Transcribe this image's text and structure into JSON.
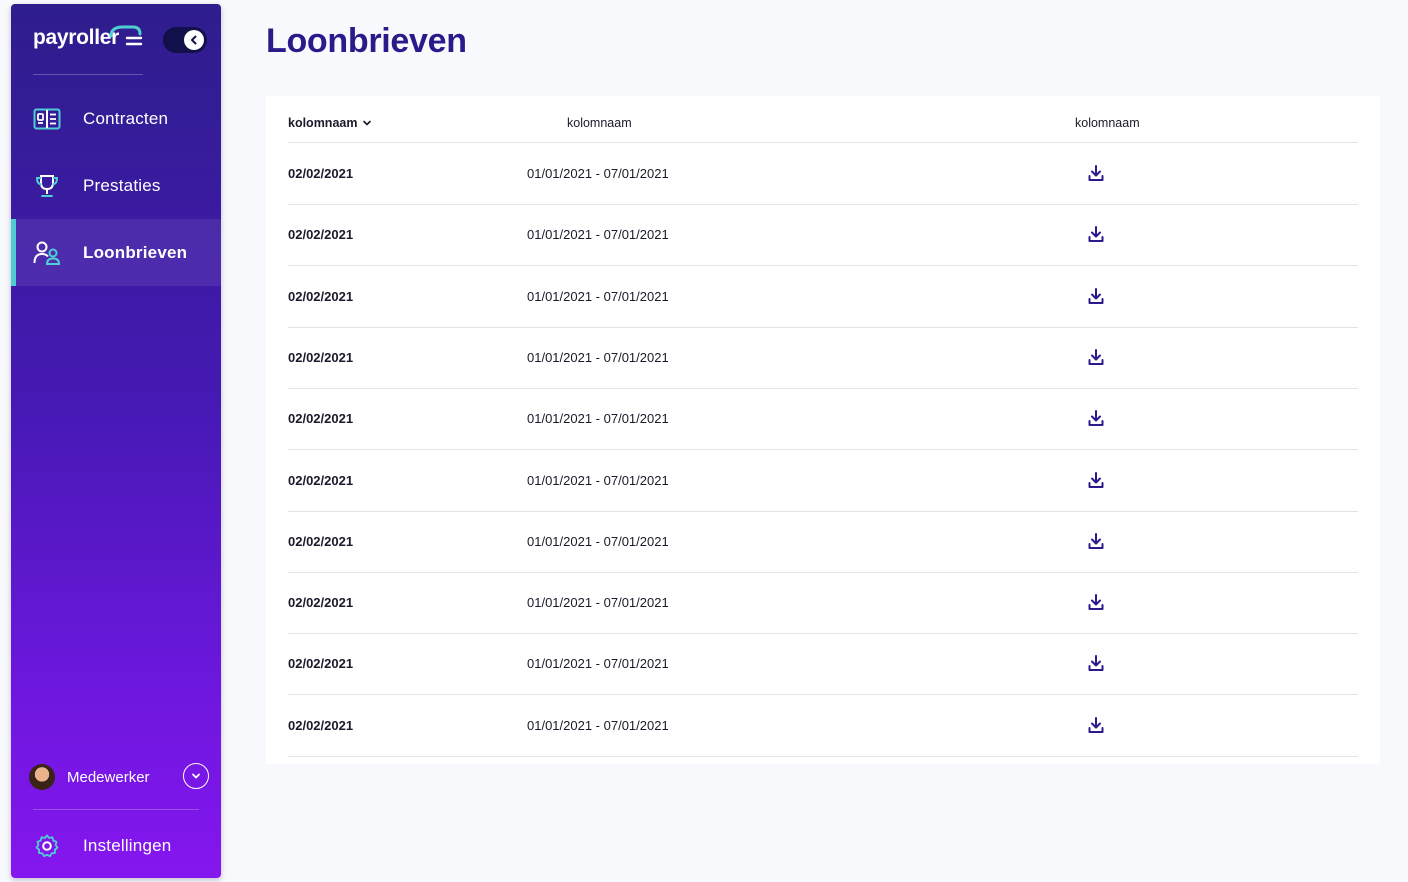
{
  "brand": {
    "name": "payroller",
    "accent": "#4ecdd2"
  },
  "sidebar": {
    "toggle_icon": "chevron-left-icon",
    "items": [
      {
        "label": "Contracten",
        "icon": "contract-card-icon",
        "active": false
      },
      {
        "label": "Prestaties",
        "icon": "trophy-icon",
        "active": false
      },
      {
        "label": "Loonbrieven",
        "icon": "users-icon",
        "active": true
      }
    ],
    "user": {
      "name": "Medewerker",
      "dropdown_icon": "chevron-down-icon"
    },
    "settings": {
      "label": "Instellingen",
      "icon": "gear-icon"
    }
  },
  "page": {
    "title": "Loonbrieven"
  },
  "table": {
    "headers": [
      "kolomnaam",
      "kolomnaam",
      "kolomnaam"
    ],
    "sort_icon": "chevron-down-icon",
    "rows": [
      {
        "date": "02/02/2021",
        "period": "01/01/2021 - 07/01/2021"
      },
      {
        "date": "02/02/2021",
        "period": "01/01/2021 - 07/01/2021"
      },
      {
        "date": "02/02/2021",
        "period": "01/01/2021 - 07/01/2021"
      },
      {
        "date": "02/02/2021",
        "period": "01/01/2021 - 07/01/2021"
      },
      {
        "date": "02/02/2021",
        "period": "01/01/2021 - 07/01/2021"
      },
      {
        "date": "02/02/2021",
        "period": "01/01/2021 - 07/01/2021"
      },
      {
        "date": "02/02/2021",
        "period": "01/01/2021 - 07/01/2021"
      },
      {
        "date": "02/02/2021",
        "period": "01/01/2021 - 07/01/2021"
      },
      {
        "date": "02/02/2021",
        "period": "01/01/2021 - 07/01/2021"
      },
      {
        "date": "02/02/2021",
        "period": "01/01/2021 - 07/01/2021"
      }
    ],
    "action_icon": "download-icon"
  },
  "colors": {
    "primary": "#2a1a8a",
    "sidebar_top": "#2e1d8c",
    "sidebar_bottom": "#8516ee"
  }
}
